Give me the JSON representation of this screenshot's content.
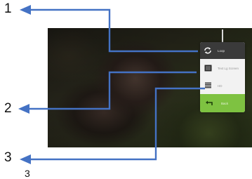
{
  "callouts": [
    "1",
    "2",
    "3",
    "3"
  ],
  "menu": {
    "items": [
      {
        "icon": "loop-icon",
        "label": "Loop"
      },
      {
        "icon": "caption-icon",
        "label": "Text Lg Screen"
      },
      {
        "icon": "quality-icon",
        "label": "HD"
      },
      {
        "icon": "back-arrow-icon",
        "label": "Back"
      }
    ]
  },
  "colors": {
    "arrow": "#4472c4",
    "menu_background": "#f2f2f2",
    "loop_row": "#3a3a3a",
    "back_row": "#7ec241"
  }
}
